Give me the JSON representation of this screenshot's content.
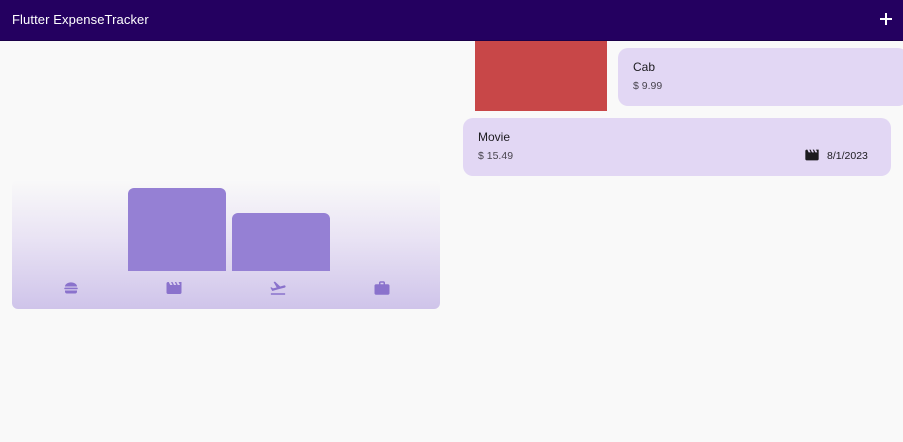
{
  "app": {
    "title": "Flutter ExpenseTracker",
    "add_icon": "plus-icon"
  },
  "chart": {
    "categories": [
      "food",
      "leisure",
      "travel",
      "work"
    ],
    "category_icons": [
      "hamburger-icon",
      "movie-clapper-icon",
      "flight-takeoff-icon",
      "briefcase-icon"
    ],
    "relative_heights": [
      0,
      1.0,
      0.7,
      0
    ]
  },
  "expenses": [
    {
      "title": "Cab",
      "amount": "$ 9.99"
    },
    {
      "title": "Movie",
      "amount": "$ 15.49",
      "category_icon": "movie-clapper-icon",
      "date": "8/1/2023"
    }
  ],
  "colors": {
    "app_bar": "#240060",
    "bar": "#9580d4",
    "card": "#e2d7f4",
    "dismiss_background": "#c84748",
    "icon": "#8a72cc"
  }
}
